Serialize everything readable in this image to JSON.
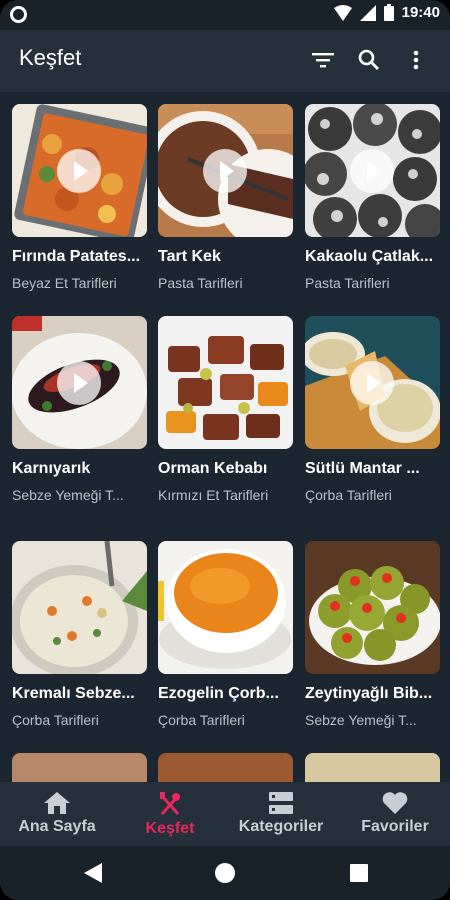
{
  "status": {
    "time": "19:40"
  },
  "header": {
    "title": "Keşfet"
  },
  "colors": {
    "accent": "#e8265f",
    "appbar": "#26303a",
    "background": "#1c2630"
  },
  "recipes": [
    {
      "name": "Fırında Patates...",
      "category": "Beyaz Et Tarifleri"
    },
    {
      "name": "Tart Kek",
      "category": "Pasta Tarifleri"
    },
    {
      "name": "Kakaolu Çatlak...",
      "category": "Pasta Tarifleri"
    },
    {
      "name": "Karnıyarık",
      "category": "Sebze Yemeği T..."
    },
    {
      "name": "Orman Kebabı",
      "category": "Kırmızı Et Tarifleri"
    },
    {
      "name": "Sütlü Mantar ...",
      "category": "Çorba Tarifleri"
    },
    {
      "name": "Kremalı Sebze...",
      "category": "Çorba Tarifleri"
    },
    {
      "name": "Ezogelin Çorb...",
      "category": "Çorba Tarifleri"
    },
    {
      "name": "Zeytinyağlı Bib...",
      "category": "Sebze Yemeği T..."
    }
  ],
  "nav": {
    "items": [
      {
        "label": "Ana Sayfa",
        "icon": "home-icon"
      },
      {
        "label": "Keşfet",
        "icon": "cutlery-icon"
      },
      {
        "label": "Kategoriler",
        "icon": "categories-icon"
      },
      {
        "label": "Favoriler",
        "icon": "heart-icon"
      }
    ],
    "active": "Keşfet"
  }
}
